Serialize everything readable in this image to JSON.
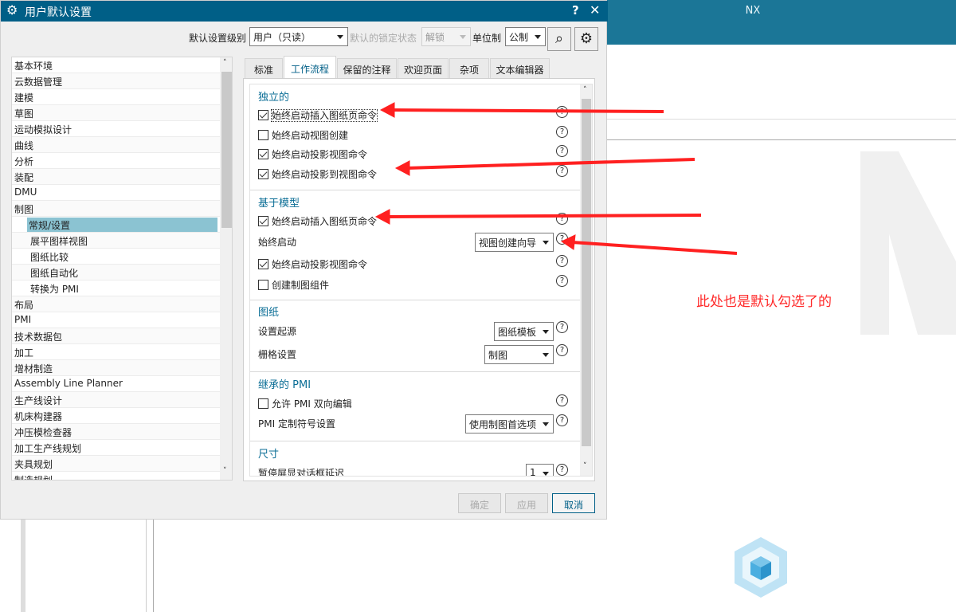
{
  "app": {
    "title": "NX"
  },
  "annotation": {
    "note": "此处也是默认勾选了的",
    "color": "#ff2020"
  },
  "dialog": {
    "title": "用户默认设置",
    "help": "?",
    "close": "✕",
    "toolbar": {
      "level_label": "默认设置级别",
      "level_value": "用户（只读）",
      "lock_label": "默认的锁定状态",
      "lock_value": "解锁",
      "unit_label": "单位制",
      "unit_value": "公制"
    },
    "tree": [
      {
        "label": "基本环境"
      },
      {
        "label": "云数据管理"
      },
      {
        "label": "建模"
      },
      {
        "label": "草图"
      },
      {
        "label": "运动模拟设计"
      },
      {
        "label": "曲线"
      },
      {
        "label": "分析"
      },
      {
        "label": "装配"
      },
      {
        "label": "DMU"
      },
      {
        "label": "制图"
      },
      {
        "label": "常规/设置",
        "child": true,
        "selected": true
      },
      {
        "label": "展平图样视图",
        "child": true
      },
      {
        "label": "图纸比较",
        "child": true
      },
      {
        "label": "图纸自动化",
        "child": true
      },
      {
        "label": "转换为 PMI",
        "child": true
      },
      {
        "label": "布局"
      },
      {
        "label": "PMI"
      },
      {
        "label": "技术数据包"
      },
      {
        "label": "加工"
      },
      {
        "label": "增材制造"
      },
      {
        "label": "Assembly Line Planner"
      },
      {
        "label": "生产线设计"
      },
      {
        "label": "机床构建器"
      },
      {
        "label": "冲压模检查器"
      },
      {
        "label": "加工生产线规划"
      },
      {
        "label": "夹具规划"
      },
      {
        "label": "制造规划"
      }
    ],
    "tabs": [
      "标准",
      "工作流程",
      "保留的注释",
      "欢迎页面",
      "杂项",
      "文本编辑器"
    ],
    "active_tab": "工作流程",
    "sections": {
      "s1": {
        "title": "独立的",
        "items": [
          {
            "label": "始终启动插入图纸页命令",
            "checked": true
          },
          {
            "label": "始终启动视图创建",
            "checked": false
          },
          {
            "label": "始终启动投影视图命令",
            "checked": true
          },
          {
            "label": "始终启动投影到视图命令",
            "checked": true
          }
        ]
      },
      "s2": {
        "title": "基于模型",
        "i0": {
          "label": "始终启动插入图纸页命令",
          "checked": true
        },
        "i1": {
          "label": "始终启动",
          "value": "视图创建向导"
        },
        "i2": {
          "label": "始终启动投影视图命令",
          "checked": true
        },
        "i3": {
          "label": "创建制图组件",
          "checked": false
        }
      },
      "s3": {
        "title": "图纸",
        "i0": {
          "label": "设置起源",
          "value": "图纸模板"
        },
        "i1": {
          "label": "栅格设置",
          "value": "制图"
        }
      },
      "s4": {
        "title": "继承的 PMI",
        "i0": {
          "label": "允许 PMI 双向编辑",
          "checked": false
        },
        "i1": {
          "label": "PMI 定制符号设置",
          "value": "使用制图首选项"
        }
      },
      "s5": {
        "title": "尺寸",
        "i0": {
          "label": "暂停屏显对话框延迟",
          "value": "1"
        }
      }
    },
    "buttons": {
      "ok": "确定",
      "apply": "应用",
      "cancel": "取消"
    }
  }
}
